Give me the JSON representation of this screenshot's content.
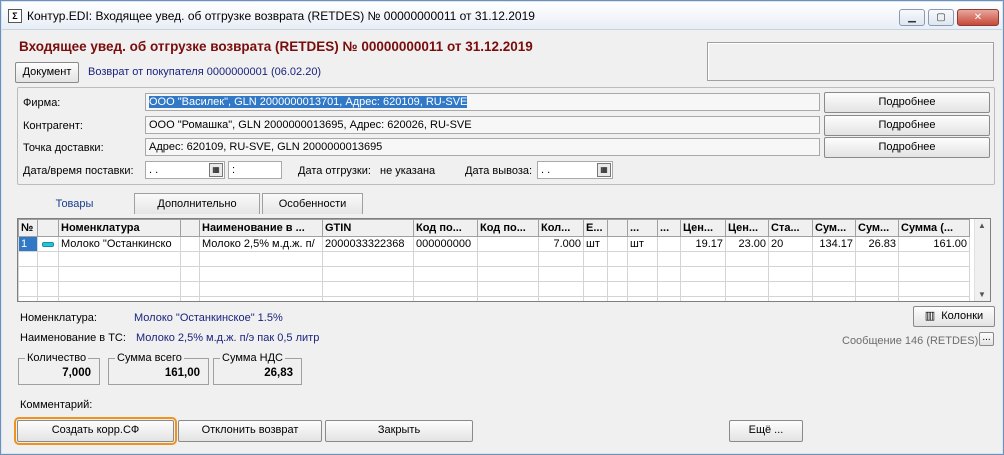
{
  "window": {
    "title": "Контур.EDI: Входящее увед. об отгрузке возврата (RETDES) № 00000000011 от 31.12.2019",
    "icon": "document-app-icon",
    "controls": [
      "minimize-icon",
      "maximize-icon",
      "close-icon"
    ]
  },
  "header": {
    "heading": "Входящее увед. об отгрузке возврата (RETDES) № 00000000011 от 31.12.2019",
    "document_button": "Документ",
    "return_link": "Возврат от покупателя 0000000001 (06.02.20)"
  },
  "fields": {
    "firm_label": "Фирма:",
    "firm_value": "ООО \"Василек\", GLN 2000000013701, Адрес: 620109, RU-SVE",
    "counterparty_label": "Контрагент:",
    "counterparty_value": "ООО \"Ромашка\", GLN 2000000013695, Адрес: 620026, RU-SVE",
    "delivery_point_label": "Точка доставки:",
    "delivery_point_value": "Адрес: 620109, RU-SVE, GLN 2000000013695",
    "details_button": "Подробнее",
    "delivery_datetime_label": "Дата/время поставки:",
    "delivery_date_value": ".  .",
    "delivery_time_value": ":",
    "shipment_date_label": "Дата отгрузки:",
    "shipment_date_value": "не указана",
    "pickup_date_label": "Дата вывоза:",
    "pickup_date_value": ".  ."
  },
  "tabs": [
    {
      "label": "Товары",
      "active": true
    },
    {
      "label": "Дополнительно",
      "active": false
    },
    {
      "label": "Особенности",
      "active": false
    }
  ],
  "grid": {
    "columns": [
      "№",
      "",
      "Номенклатура",
      "",
      "Наименование в ...",
      "GTIN",
      "Код по...",
      "Код по...",
      "Кол...",
      "Е...",
      "",
      "...",
      "...",
      "Цен...",
      "Цен...",
      "Ста...",
      "Сум...",
      "Сум...",
      "Сумма (..."
    ],
    "rows": [
      [
        "1",
        "",
        "Молоко \"Останкинско",
        "",
        "Молоко 2,5% м.д.ж. п/",
        "2000033322368",
        "000000000",
        "",
        "7.000",
        "шт",
        "",
        "шт",
        "",
        "19.17",
        "23.00",
        "20",
        "134.17",
        "26.83",
        "161.00"
      ]
    ]
  },
  "details": {
    "nomenclature_label": "Номенклатура:",
    "nomenclature_value": "Молоко \"Останкинское\" 1.5%",
    "ts_name_label": "Наименование в ТС:",
    "ts_name_value": "Молоко 2,5% м.д.ж. п/э пак 0,5 литр",
    "columns_button": "Колонки",
    "message_info": "Сообщение 146 (RETDES)",
    "message_more": "..."
  },
  "totals": {
    "quantity_label": "Количество",
    "quantity_value": "7,000",
    "sum_total_label": "Сумма всего",
    "sum_total_value": "161,00",
    "vat_label": "Сумма НДС",
    "vat_value": "26,83"
  },
  "footer": {
    "comment_label": "Комментарий:",
    "create_corr_button": "Создать корр.СФ",
    "reject_button": "Отклонить возврат",
    "close_button": "Закрыть",
    "more_button": "Ещё ..."
  },
  "colors": {
    "heading": "#7a0c0c",
    "link": "#1a237e",
    "selection": "#3178c6",
    "highlight": "#f0921e"
  }
}
